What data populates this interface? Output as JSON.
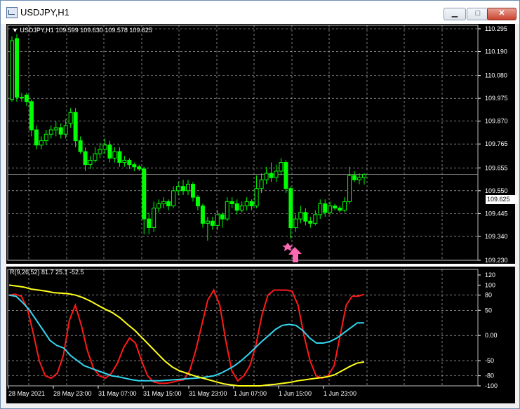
{
  "window": {
    "title": "USDJPY,H1",
    "controls": [
      {
        "name": "minimize",
        "glyph": "▁"
      },
      {
        "name": "maximize",
        "glyph": "□"
      },
      {
        "name": "close",
        "glyph": "✕"
      }
    ]
  },
  "main_chart": {
    "header": "USDJPY,H1  109.599 109.630 109.578 109.625",
    "price_axis": [
      "110.295",
      "110.190",
      "110.080",
      "109.975",
      "109.870",
      "109.765",
      "109.655",
      "109.550",
      "109.445",
      "109.340",
      "109.230"
    ],
    "current_price": "109.625",
    "marker_color": "#ff69b4",
    "colors": {
      "bull": "#00ff00",
      "bear": "#00ff00",
      "grid": "#d0d0d0",
      "background": "#000000"
    }
  },
  "indicator": {
    "header": "R(9,26,52) 81.7 25.1 -52.5",
    "axis": [
      "120",
      "100",
      "80",
      "50",
      "0.00",
      "-50",
      "-80",
      "-100"
    ],
    "colors": {
      "fast": "#ff1a1a",
      "mid": "#33d6f0",
      "slow": "#ffff1a"
    }
  },
  "time_axis": [
    "28 May 2021",
    "28 May 23:00",
    "31 May 07:00",
    "31 May 15:00",
    "31 May 23:00",
    "1 Jun 07:00",
    "1 Jun 15:00",
    "1 Jun 23:00"
  ],
  "chart_data": [
    {
      "type": "candlestick",
      "title": "USDJPY,H1",
      "ylim": [
        109.23,
        110.295
      ],
      "candles": [
        {
          "o": 109.97,
          "c": 110.24,
          "h": 110.26,
          "l": 109.96
        },
        {
          "o": 110.25,
          "c": 109.98,
          "h": 110.27,
          "l": 109.96
        },
        {
          "o": 109.98,
          "c": 109.98,
          "h": 110.0,
          "l": 109.96
        },
        {
          "o": 109.99,
          "c": 109.96,
          "h": 110.0,
          "l": 109.94
        },
        {
          "o": 109.96,
          "c": 109.83,
          "h": 109.97,
          "l": 109.8
        },
        {
          "o": 109.83,
          "c": 109.76,
          "h": 109.85,
          "l": 109.74
        },
        {
          "o": 109.76,
          "c": 109.78,
          "h": 109.8,
          "l": 109.74
        },
        {
          "o": 109.78,
          "c": 109.81,
          "h": 109.83,
          "l": 109.76
        },
        {
          "o": 109.81,
          "c": 109.83,
          "h": 109.85,
          "l": 109.79
        },
        {
          "o": 109.83,
          "c": 109.84,
          "h": 109.87,
          "l": 109.8
        },
        {
          "o": 109.84,
          "c": 109.81,
          "h": 109.86,
          "l": 109.79
        },
        {
          "o": 109.81,
          "c": 109.85,
          "h": 109.88,
          "l": 109.79
        },
        {
          "o": 109.86,
          "c": 109.91,
          "h": 109.93,
          "l": 109.84
        },
        {
          "o": 109.91,
          "c": 109.78,
          "h": 109.93,
          "l": 109.75
        },
        {
          "o": 109.78,
          "c": 109.73,
          "h": 109.8,
          "l": 109.72
        },
        {
          "o": 109.73,
          "c": 109.67,
          "h": 109.75,
          "l": 109.64
        },
        {
          "o": 109.67,
          "c": 109.69,
          "h": 109.71,
          "l": 109.65
        },
        {
          "o": 109.69,
          "c": 109.72,
          "h": 109.75,
          "l": 109.68
        },
        {
          "o": 109.72,
          "c": 109.74,
          "h": 109.77,
          "l": 109.7
        },
        {
          "o": 109.74,
          "c": 109.76,
          "h": 109.79,
          "l": 109.72
        },
        {
          "o": 109.76,
          "c": 109.7,
          "h": 109.78,
          "l": 109.68
        },
        {
          "o": 109.7,
          "c": 109.73,
          "h": 109.75,
          "l": 109.68
        },
        {
          "o": 109.73,
          "c": 109.68,
          "h": 109.75,
          "l": 109.66
        },
        {
          "o": 109.68,
          "c": 109.69,
          "h": 109.71,
          "l": 109.66
        },
        {
          "o": 109.69,
          "c": 109.67,
          "h": 109.7,
          "l": 109.65
        },
        {
          "o": 109.67,
          "c": 109.66,
          "h": 109.68,
          "l": 109.64
        },
        {
          "o": 109.66,
          "c": 109.65,
          "h": 109.67,
          "l": 109.64
        },
        {
          "o": 109.65,
          "c": 109.42,
          "h": 109.66,
          "l": 109.35
        },
        {
          "o": 109.42,
          "c": 109.38,
          "h": 109.45,
          "l": 109.35
        },
        {
          "o": 109.38,
          "c": 109.47,
          "h": 109.5,
          "l": 109.36
        },
        {
          "o": 109.47,
          "c": 109.49,
          "h": 109.51,
          "l": 109.45
        },
        {
          "o": 109.49,
          "c": 109.5,
          "h": 109.52,
          "l": 109.47
        },
        {
          "o": 109.5,
          "c": 109.48,
          "h": 109.51,
          "l": 109.46
        },
        {
          "o": 109.48,
          "c": 109.55,
          "h": 109.57,
          "l": 109.47
        },
        {
          "o": 109.55,
          "c": 109.57,
          "h": 109.59,
          "l": 109.53
        },
        {
          "o": 109.57,
          "c": 109.55,
          "h": 109.6,
          "l": 109.53
        },
        {
          "o": 109.55,
          "c": 109.58,
          "h": 109.6,
          "l": 109.53
        },
        {
          "o": 109.58,
          "c": 109.52,
          "h": 109.59,
          "l": 109.5
        },
        {
          "o": 109.52,
          "c": 109.48,
          "h": 109.53,
          "l": 109.46
        },
        {
          "o": 109.48,
          "c": 109.4,
          "h": 109.49,
          "l": 109.38
        },
        {
          "o": 109.4,
          "c": 109.41,
          "h": 109.43,
          "l": 109.32
        },
        {
          "o": 109.41,
          "c": 109.39,
          "h": 109.43,
          "l": 109.37
        },
        {
          "o": 109.39,
          "c": 109.44,
          "h": 109.46,
          "l": 109.37
        },
        {
          "o": 109.44,
          "c": 109.42,
          "h": 109.45,
          "l": 109.38
        },
        {
          "o": 109.42,
          "c": 109.5,
          "h": 109.52,
          "l": 109.41
        },
        {
          "o": 109.5,
          "c": 109.49,
          "h": 109.52,
          "l": 109.47
        },
        {
          "o": 109.49,
          "c": 109.46,
          "h": 109.51,
          "l": 109.44
        },
        {
          "o": 109.46,
          "c": 109.48,
          "h": 109.5,
          "l": 109.45
        },
        {
          "o": 109.48,
          "c": 109.5,
          "h": 109.52,
          "l": 109.46
        },
        {
          "o": 109.5,
          "c": 109.48,
          "h": 109.51,
          "l": 109.46
        },
        {
          "o": 109.48,
          "c": 109.56,
          "h": 109.62,
          "l": 109.47
        },
        {
          "o": 109.56,
          "c": 109.6,
          "h": 109.63,
          "l": 109.54
        },
        {
          "o": 109.6,
          "c": 109.63,
          "h": 109.66,
          "l": 109.58
        },
        {
          "o": 109.63,
          "c": 109.61,
          "h": 109.68,
          "l": 109.59
        },
        {
          "o": 109.61,
          "c": 109.64,
          "h": 109.67,
          "l": 109.59
        },
        {
          "o": 109.64,
          "c": 109.68,
          "h": 109.7,
          "l": 109.62
        },
        {
          "o": 109.68,
          "c": 109.56,
          "h": 109.69,
          "l": 109.54
        },
        {
          "o": 109.56,
          "c": 109.38,
          "h": 109.57,
          "l": 109.33
        },
        {
          "o": 109.38,
          "c": 109.42,
          "h": 109.44,
          "l": 109.36
        },
        {
          "o": 109.42,
          "c": 109.45,
          "h": 109.48,
          "l": 109.4
        },
        {
          "o": 109.45,
          "c": 109.41,
          "h": 109.47,
          "l": 109.39
        },
        {
          "o": 109.41,
          "c": 109.4,
          "h": 109.43,
          "l": 109.38
        },
        {
          "o": 109.4,
          "c": 109.44,
          "h": 109.46,
          "l": 109.39
        },
        {
          "o": 109.44,
          "c": 109.49,
          "h": 109.51,
          "l": 109.42
        },
        {
          "o": 109.49,
          "c": 109.45,
          "h": 109.51,
          "l": 109.43
        },
        {
          "o": 109.45,
          "c": 109.48,
          "h": 109.5,
          "l": 109.44
        },
        {
          "o": 109.48,
          "c": 109.47,
          "h": 109.49,
          "l": 109.46
        },
        {
          "o": 109.47,
          "c": 109.46,
          "h": 109.48,
          "l": 109.45
        },
        {
          "o": 109.46,
          "c": 109.5,
          "h": 109.52,
          "l": 109.45
        },
        {
          "o": 109.5,
          "c": 109.62,
          "h": 109.66,
          "l": 109.49
        },
        {
          "o": 109.62,
          "c": 109.6,
          "h": 109.64,
          "l": 109.59
        },
        {
          "o": 109.6,
          "c": 109.61,
          "h": 109.63,
          "l": 109.58
        },
        {
          "o": 109.61,
          "c": 109.625,
          "h": 109.63,
          "l": 109.578
        }
      ]
    },
    {
      "type": "line",
      "title": "R(9,26,52) 81.7 25.1 -52.5",
      "ylim": [
        -100,
        120
      ],
      "series": [
        {
          "values": [
            80,
            82,
            78,
            55,
            5,
            -50,
            -80,
            -85,
            -75,
            -40,
            30,
            60,
            20,
            -30,
            -65,
            -80,
            -85,
            -75,
            -55,
            -25,
            -5,
            -15,
            -50,
            -80,
            -92,
            -95,
            -95,
            -93,
            -90,
            -88,
            -70,
            -30,
            20,
            70,
            90,
            60,
            -10,
            -70,
            -90,
            -80,
            -60,
            -20,
            40,
            80,
            90,
            90,
            90,
            88,
            60,
            0,
            -50,
            -80,
            -85,
            -80,
            -60,
            0,
            60,
            78,
            78,
            81.7
          ]
        },
        {
          "values": [
            80,
            78,
            65,
            50,
            30,
            10,
            -10,
            -20,
            -25,
            -40,
            -50,
            -60,
            -65,
            -70,
            -75,
            -80,
            -82,
            -85,
            -88,
            -90,
            -90,
            -90,
            -90,
            -89,
            -88,
            -87,
            -86,
            -85,
            -84,
            -82,
            -80,
            -75,
            -68,
            -60,
            -50,
            -38,
            -25,
            -12,
            0,
            12,
            20,
            22,
            20,
            10,
            -5,
            -15,
            -15,
            -12,
            -5,
            5,
            15,
            25,
            25.1
          ]
        },
        {
          "values": [
            100,
            98,
            96,
            92,
            90,
            88,
            85,
            84,
            83,
            80,
            75,
            68,
            60,
            52,
            45,
            35,
            22,
            10,
            -5,
            -20,
            -35,
            -50,
            -62,
            -70,
            -75,
            -80,
            -84,
            -88,
            -92,
            -96,
            -98,
            -100,
            -100,
            -100,
            -100,
            -98,
            -97,
            -95,
            -93,
            -90,
            -88,
            -86,
            -84,
            -82,
            -78,
            -70,
            -62,
            -55,
            -52.5
          ]
        }
      ]
    }
  ]
}
